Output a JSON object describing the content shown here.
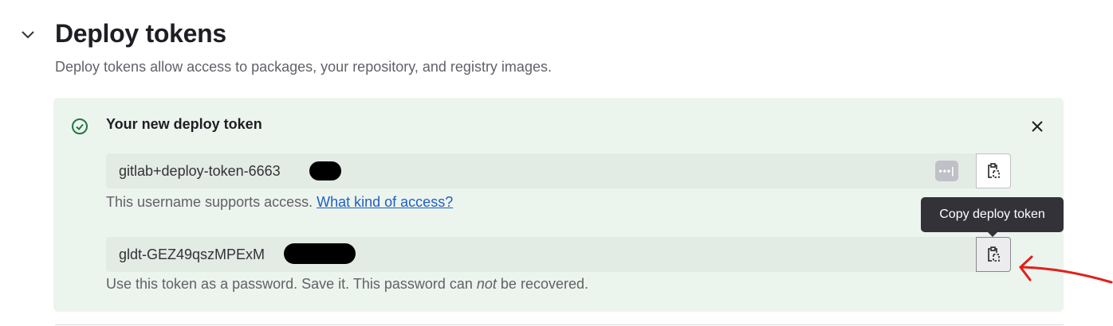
{
  "section": {
    "title": "Deploy tokens",
    "description": "Deploy tokens allow access to packages, your repository, and registry images."
  },
  "alert": {
    "title": "Your new deploy token",
    "icon": "check-circle-icon",
    "close_icon": "close-icon",
    "username": {
      "value": "gitlab+deploy-token-6663",
      "help": "This username supports access. ",
      "help_link": "What kind of access?"
    },
    "token": {
      "value": "gldt-GEZ49qszMPExM",
      "help_pre": "Use this token as a password. Save it. This password can ",
      "help_em": "not",
      "help_post": " be recovered."
    },
    "tooltip": "Copy deploy token",
    "password_manager_icon": "•••|"
  },
  "colors": {
    "success_bg": "#ecf4ee",
    "success_icon": "#217645",
    "link": "#1f5fc4",
    "annotation": "#e0201b"
  }
}
